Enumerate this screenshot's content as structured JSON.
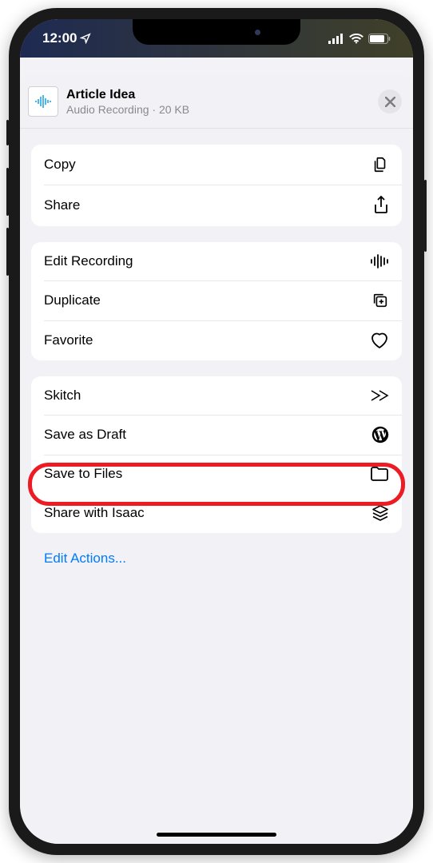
{
  "status": {
    "time": "12:00"
  },
  "file": {
    "title": "Article Idea",
    "type": "Audio Recording",
    "size": "20 KB"
  },
  "groups": [
    [
      {
        "label": "Copy",
        "icon": "copy"
      },
      {
        "label": "Share",
        "icon": "share"
      }
    ],
    [
      {
        "label": "Edit Recording",
        "icon": "waveform"
      },
      {
        "label": "Duplicate",
        "icon": "duplicate"
      },
      {
        "label": "Favorite",
        "icon": "heart"
      }
    ],
    [
      {
        "label": "Skitch",
        "icon": "skitch"
      },
      {
        "label": "Save as Draft",
        "icon": "wordpress"
      },
      {
        "label": "Save to Files",
        "icon": "folder",
        "highlighted": true
      },
      {
        "label": "Share with Isaac",
        "icon": "stack"
      }
    ]
  ],
  "editActions": "Edit Actions..."
}
